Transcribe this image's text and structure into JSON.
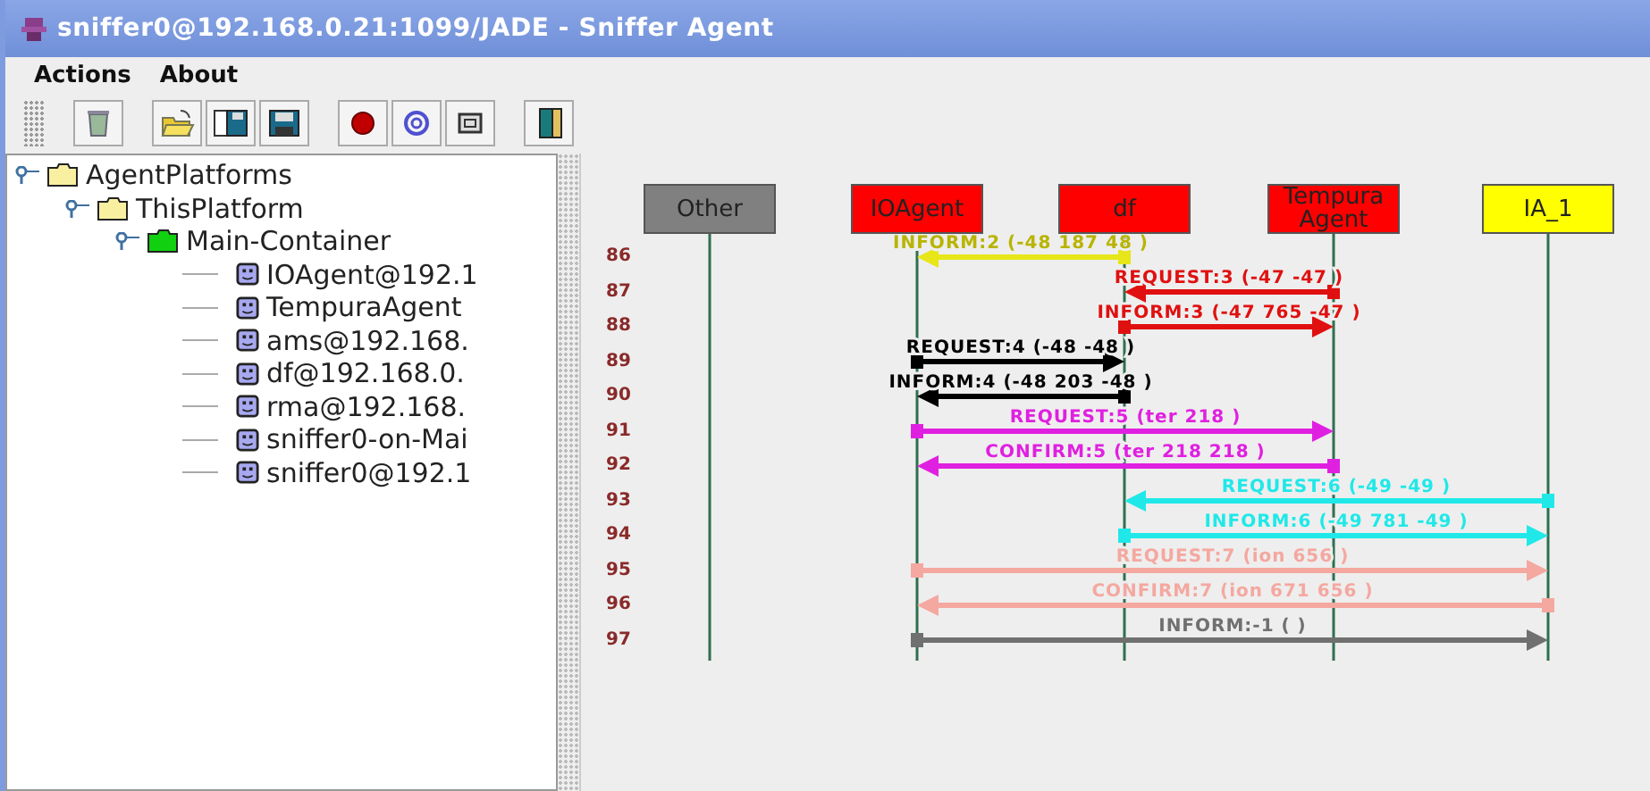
{
  "window": {
    "title": "sniffer0@192.168.0.21:1099/JADE - Sniffer Agent"
  },
  "menu": [
    "Actions",
    "About"
  ],
  "toolbar": [
    {
      "kind": "trash"
    },
    {
      "kind": "open"
    },
    {
      "kind": "saveas"
    },
    {
      "kind": "save"
    },
    {
      "kind": "record"
    },
    {
      "kind": "swirl"
    },
    {
      "kind": "frame"
    },
    {
      "kind": "exit"
    }
  ],
  "tree": [
    {
      "label": "AgentPlatforms",
      "kind": "folder",
      "expanded": true,
      "children": [
        {
          "label": "ThisPlatform",
          "kind": "folder",
          "expanded": true,
          "children": [
            {
              "label": "Main-Container",
              "kind": "container",
              "expanded": true,
              "children": [
                {
                  "label": "IOAgent@192.1",
                  "kind": "agent"
                },
                {
                  "label": "TempuraAgent",
                  "kind": "agent"
                },
                {
                  "label": "ams@192.168.",
                  "kind": "agent"
                },
                {
                  "label": "df@192.168.0.",
                  "kind": "agent"
                },
                {
                  "label": "rma@192.168.",
                  "kind": "agent"
                },
                {
                  "label": "sniffer0-on-Mai",
                  "kind": "agent"
                },
                {
                  "label": "sniffer0@192.1",
                  "kind": "agent"
                }
              ]
            }
          ]
        }
      ]
    }
  ],
  "agents": [
    {
      "name": "Other",
      "color": "#808080"
    },
    {
      "name": "IOAgent",
      "color": "#ff0000"
    },
    {
      "name": "df",
      "color": "#ff0000"
    },
    {
      "name": "TempuraAgent",
      "color": "#ff0000"
    },
    {
      "name": "IA_1",
      "color": "#ffff00"
    }
  ],
  "messages": [
    {
      "row": "86",
      "label": "INFORM:2 (-48  187  48 )",
      "color": "#e6e619"
    },
    {
      "row": "87",
      "label": "REQUEST:3 (-47  -47    )",
      "color": "#e01010"
    },
    {
      "row": "88",
      "label": "INFORM:3 (-47  765  -47 )",
      "color": "#e01010"
    },
    {
      "row": "89",
      "label": "REQUEST:4 (-48  -48    )",
      "color": "#000000"
    },
    {
      "row": "90",
      "label": "INFORM:4 (-48  203  -48 )",
      "color": "#000000"
    },
    {
      "row": "91",
      "label": "REQUEST:5 (ter  218    )",
      "color": "#e020e0"
    },
    {
      "row": "92",
      "label": "CONFIRM:5 (ter  218  218 )",
      "color": "#e020e0"
    },
    {
      "row": "93",
      "label": "REQUEST:6 (-49  -49    )",
      "color": "#20e8e8"
    },
    {
      "row": "94",
      "label": "INFORM:6 (-49  781  -49 )",
      "color": "#20e8e8"
    },
    {
      "row": "95",
      "label": "REQUEST:7 (ion  656    )",
      "color": "#f4a8a0"
    },
    {
      "row": "96",
      "label": "CONFIRM:7 (ion  671  656 )",
      "color": "#f4a8a0"
    },
    {
      "row": "97",
      "label": "INFORM:-1 (        )",
      "color": "#707070"
    }
  ]
}
